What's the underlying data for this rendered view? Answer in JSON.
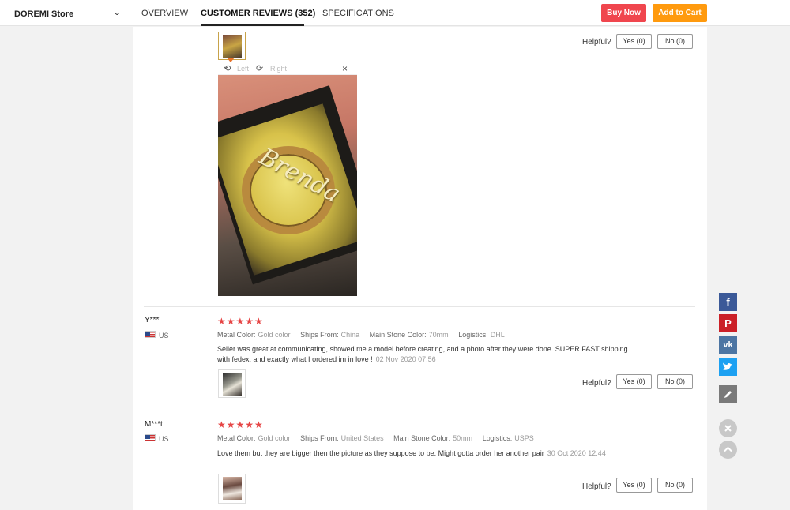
{
  "header": {
    "store_name": "DOREMI Store",
    "tabs": [
      {
        "label": "OVERVIEW"
      },
      {
        "label": "CUSTOMER REVIEWS (352)"
      },
      {
        "label": "SPECIFICATIONS"
      }
    ],
    "buy_now": "Buy Now",
    "add_to_cart": "Add to Cart"
  },
  "viewer": {
    "rotate_left": "Left",
    "rotate_right": "Right",
    "close": "×",
    "image_text": "Brenda"
  },
  "helpful_label": "Helpful?",
  "top_vote": {
    "yes": "Yes (0)",
    "no": "No (0)"
  },
  "reviews": [
    {
      "name": "Y***",
      "country": "US",
      "stars": "★★★★★",
      "attributes": [
        {
          "label": "Metal Color:",
          "value": "Gold color"
        },
        {
          "label": "Ships From:",
          "value": "China"
        },
        {
          "label": "Main Stone Color:",
          "value": "70mm"
        },
        {
          "label": "Logistics:",
          "value": "DHL"
        }
      ],
      "text": "Seller was great at communicating, showed me a model before creating, and a photo after they were done. SUPER FAST shipping with fedex, and exactly what I ordered im in love !",
      "date": "02 Nov 2020 07:56",
      "yes": "Yes (0)",
      "no": "No (0)"
    },
    {
      "name": "M***t",
      "country": "US",
      "stars": "★★★★★",
      "attributes": [
        {
          "label": "Metal Color:",
          "value": "Gold color"
        },
        {
          "label": "Ships From:",
          "value": "United States"
        },
        {
          "label": "Main Stone Color:",
          "value": "50mm"
        },
        {
          "label": "Logistics:",
          "value": "USPS"
        }
      ],
      "text": "Love them but they are bigger then the picture as they suppose to be. Might gotta order her another pair",
      "date": "30 Oct 2020 12:44",
      "yes": "Yes (0)",
      "no": "No (0)"
    }
  ],
  "side_icons": [
    "facebook-icon",
    "pinterest-icon",
    "vk-icon",
    "twitter-icon",
    "edit-icon",
    "close-icon",
    "scroll-up-icon"
  ],
  "colors": {
    "buy_now": "#f0464e",
    "add_to_cart": "#ff9a0e",
    "stars": "#e64545",
    "facebook": "#3b5998",
    "pinterest": "#cb2027",
    "vk": "#4c75a3",
    "twitter": "#1da1f2"
  }
}
